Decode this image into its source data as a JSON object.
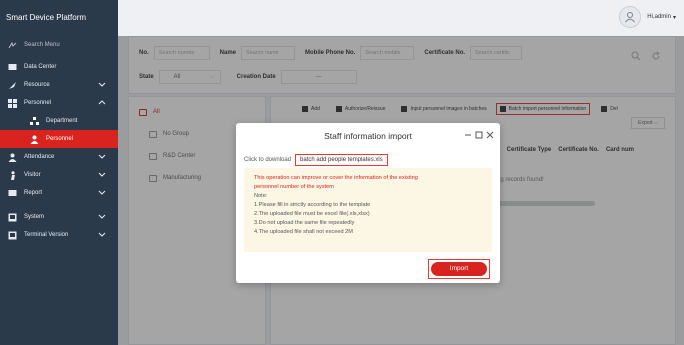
{
  "app": {
    "title": "Smart Device Platform"
  },
  "user": {
    "greeting": "Hi,admin"
  },
  "sidebar": {
    "search_label": "Search Menu",
    "items": [
      {
        "label": "Data Center",
        "icon": "monitor-icon"
      },
      {
        "label": "Resource",
        "icon": "rocket-icon"
      },
      {
        "label": "Personnel",
        "icon": "grid-icon"
      },
      {
        "label": "Department",
        "icon": "org-chart-icon",
        "sub": true
      },
      {
        "label": "Personnel",
        "icon": "person-icon",
        "sub": true,
        "active": true
      },
      {
        "label": "Attendance",
        "icon": "person-icon"
      },
      {
        "label": "Visitor",
        "icon": "person-walking-icon"
      },
      {
        "label": "Report",
        "icon": "monitor-icon"
      },
      {
        "label": "System",
        "icon": "computer-icon"
      },
      {
        "label": "Terminal Version",
        "icon": "computer-icon"
      }
    ]
  },
  "filters": {
    "no_label": "No.",
    "no_placeholder": "Search numbe",
    "name_label": "Name",
    "name_placeholder": "Search name",
    "phone_label": "Mobile Phone No.",
    "phone_placeholder": "Search mobile",
    "cert_label": "Certificate No.",
    "cert_placeholder": "Search certific",
    "state_label": "State",
    "state_value": "All",
    "date_label": "Creation Date",
    "date_sep": "—"
  },
  "tree": {
    "root": "All",
    "children": [
      "No Group",
      "R&D Center",
      "Manufacturing"
    ]
  },
  "toolbar": {
    "add": "Add",
    "authorize": "Authorize/Reissue",
    "input_images": "Input personnel images in batches",
    "batch_import": "Batch import personnel information",
    "del": "Del",
    "export": "Export"
  },
  "table": {
    "headers": [
      "rtment",
      "Certificate Type",
      "Certificate No.",
      "Card num"
    ],
    "empty": "natching records found!"
  },
  "modal": {
    "title": "Staff information import",
    "download_label": "Click to download",
    "download_link": "batch add people templates.xls",
    "notice_warn_1": "This operation can improve or cover the information of the existing",
    "notice_warn_2": "personnel number of the system",
    "note_title": "Note:",
    "notes": [
      "1.Please fill in strictly according to the template",
      "2.The uploaded file must be excel file(.xls,xlsx)",
      "3.Do not upload the same file repeatedly",
      "4.The uploaded file shall not exceed 2M"
    ],
    "import_label": "Import"
  },
  "colors": {
    "accent": "#d9231f",
    "sidebar": "#2b3a4a",
    "highlight": "#e53b34"
  }
}
